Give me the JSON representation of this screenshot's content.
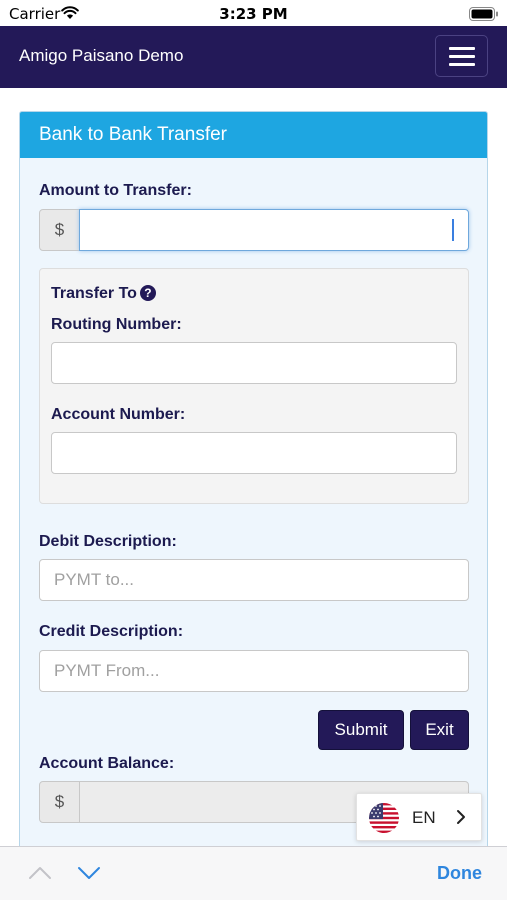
{
  "status_bar": {
    "carrier": "Carrier",
    "time": "3:23 PM"
  },
  "navbar": {
    "title": "Amigo Paisano Demo",
    "menu_icon": "hamburger-icon"
  },
  "panel": {
    "title": "Bank to Bank Transfer"
  },
  "form": {
    "amount_label": "Amount to Transfer:",
    "currency_symbol": "$",
    "amount_value": "",
    "transfer_to": {
      "heading": "Transfer To",
      "help_icon": "question-circle-icon",
      "help_glyph": "?",
      "routing_label": "Routing Number:",
      "routing_value": "",
      "account_label": "Account Number:",
      "account_value": ""
    },
    "debit_label": "Debit Description:",
    "debit_placeholder": "PYMT to...",
    "credit_label": "Credit Description:",
    "credit_placeholder": "PYMT From...",
    "submit_label": "Submit",
    "exit_label": "Exit",
    "balance_label": "Account Balance:",
    "balance_symbol": "$",
    "balance_value": ""
  },
  "language": {
    "code": "EN",
    "flag_icon": "us-flag-icon"
  },
  "accessory_bar": {
    "done_label": "Done"
  },
  "colors": {
    "navbar": "#231958",
    "panel_heading": "#1ea6e1",
    "panel_body": "#eef6fd",
    "button": "#231958",
    "done": "#2f86de"
  }
}
